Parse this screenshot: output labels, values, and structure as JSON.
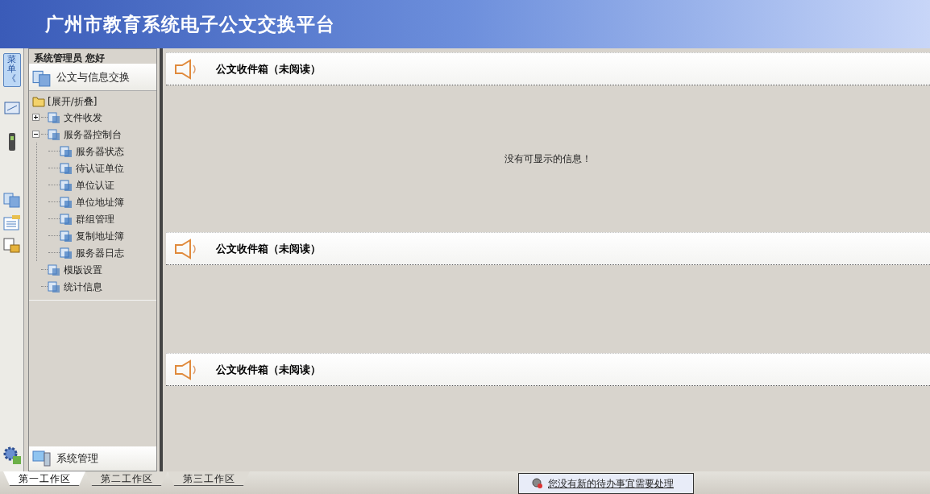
{
  "header": {
    "title": "广州市教育系统电子公文交换平台"
  },
  "menu_toggle": {
    "label": "菜单",
    "glyph": "《"
  },
  "sidebar": {
    "greeting": "系统管理员 您好",
    "section": "公文与信息交换",
    "tree_root": "[展开/折叠]",
    "tree": [
      {
        "label": "文件收发",
        "expanded": false
      },
      {
        "label": "服务器控制台",
        "expanded": true,
        "children": [
          {
            "label": "服务器状态"
          },
          {
            "label": "待认证单位"
          },
          {
            "label": "单位认证"
          },
          {
            "label": "单位地址簿"
          },
          {
            "label": "群组管理"
          },
          {
            "label": "复制地址簿"
          },
          {
            "label": "服务器日志"
          }
        ]
      },
      {
        "label": "模版设置"
      },
      {
        "label": "统计信息"
      }
    ],
    "footer_section": "系统管理"
  },
  "panels": [
    {
      "title": "公文收件箱（未阅读）",
      "message": "没有可显示的信息！"
    },
    {
      "title": "公文收件箱（未阅读）"
    },
    {
      "title": "公文收件箱（未阅读）"
    }
  ],
  "workspace_tabs": [
    {
      "label": "第一工作区",
      "selected": true
    },
    {
      "label": "第二工作区",
      "selected": false
    },
    {
      "label": "第三工作区",
      "selected": false
    }
  ],
  "notice": {
    "text": "您没有新的待办事宜需要处理"
  }
}
